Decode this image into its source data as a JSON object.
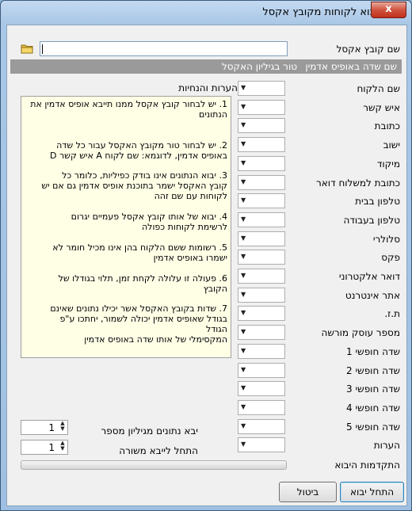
{
  "window": {
    "title": "יבוא לקוחות מקובץ אקסל",
    "close_label": "x"
  },
  "file": {
    "label": "שם קובץ אקסל",
    "value": ""
  },
  "mapping_header": {
    "field_col": "שם שדה באופיס אדמין",
    "column_col": "טור בגיליון האקסל"
  },
  "fields": [
    "שם הלקוח",
    "איש קשר",
    "כתובת",
    "ישוב",
    "מיקוד",
    "כתובת למשלוח דואר",
    "טלפון בבית",
    "טלפון בעבודה",
    "סלולרי",
    "פקס",
    "דואר אלקטרוני",
    "אתר אינטרנט",
    "ת.ז.",
    "מספר עוסק מורשה",
    "שדה חופשי 1",
    "שדה חופשי 2",
    "שדה חופשי 3",
    "שדה חופשי 4",
    "שדה חופשי 5",
    "הערות"
  ],
  "notes": {
    "title": "הערות והנחיות",
    "items": [
      "1. יש לבחור קובץ אקסל ממנו תייבא אופיס אדמין את\nהנתונים",
      "2. יש לבחור טור מקובץ האקסל עבור כל שדה\nבאופיס אדמין, לדוגמא: שם לקוח A איש קשר D",
      "3. יבוא הנתונים אינו בודק כפיליות, כלומר כל\nקובץ האקסל ישמר בתוכנת אופיס אדמין גם אם יש\nלקוחות עם שם זהה",
      "4. יבוא של אותו קובץ אקסל פעמיים יגרום\nלרשימת לקוחות כפולה",
      "5. רשומות ששם הלקוח בהן אינו מכיל חומר לא\nישמרו באופיס אדמין",
      "6. פעולה זו עלולה לקחת זמן, תלוי בגודלו של\nהקובץ",
      "7. שדות בקובץ האקסל אשר יכילו נתונים שאינם\nבגודל שאופיס אדמין יכולה לשמור, יחתכו ע\"פ\nהגודל\nהמקסימלי של אותו שדה באופיס אדמין"
    ]
  },
  "sheet": {
    "label": "יבא נתונים מגיליון מספר",
    "value": "1"
  },
  "start_row": {
    "label": "התחל לייבא משורה",
    "value": "1"
  },
  "progress": {
    "label": "התקדמות היבוא",
    "fraction": 0
  },
  "buttons": {
    "start": "התחל יבוא",
    "cancel": "ביטול"
  }
}
